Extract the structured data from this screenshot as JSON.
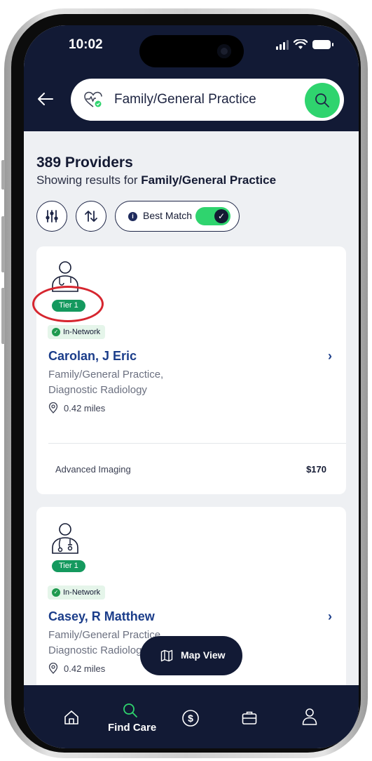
{
  "status_bar": {
    "time": "10:02"
  },
  "search": {
    "query": "Family/General Practice"
  },
  "results": {
    "count_label": "389 Providers",
    "showing_prefix": "Showing results for ",
    "showing_term": "Family/General Practice"
  },
  "filters": {
    "best_match_label": "Best Match",
    "best_match_on": true
  },
  "providers": [
    {
      "tier": "Tier 1",
      "network": "In-Network",
      "name": "Carolan, J Eric",
      "specialty_line1": "Family/General Practice,",
      "specialty_line2": "Diagnostic Radiology",
      "distance": "0.42 miles",
      "service": "Advanced Imaging",
      "price": "$170"
    },
    {
      "tier": "Tier 1",
      "network": "In-Network",
      "name": "Casey, R Matthew",
      "specialty_line1": "Family/General Practice,",
      "specialty_line2": "Diagnostic Radiology",
      "distance": "0.42 miles"
    }
  ],
  "map_view": {
    "label": "Map View"
  },
  "bottom_nav": {
    "items": [
      {
        "icon": "home-icon",
        "label": ""
      },
      {
        "icon": "search-icon",
        "label": "Find Care"
      },
      {
        "icon": "dollar-icon",
        "label": ""
      },
      {
        "icon": "briefcase-icon",
        "label": ""
      },
      {
        "icon": "profile-icon",
        "label": ""
      }
    ],
    "active": "Find Care"
  },
  "colors": {
    "header_bg": "#121a35",
    "accent_green": "#2fd46e",
    "tier_green": "#14995e",
    "name_blue": "#1b3d8a",
    "highlight_red": "#d6262f"
  }
}
